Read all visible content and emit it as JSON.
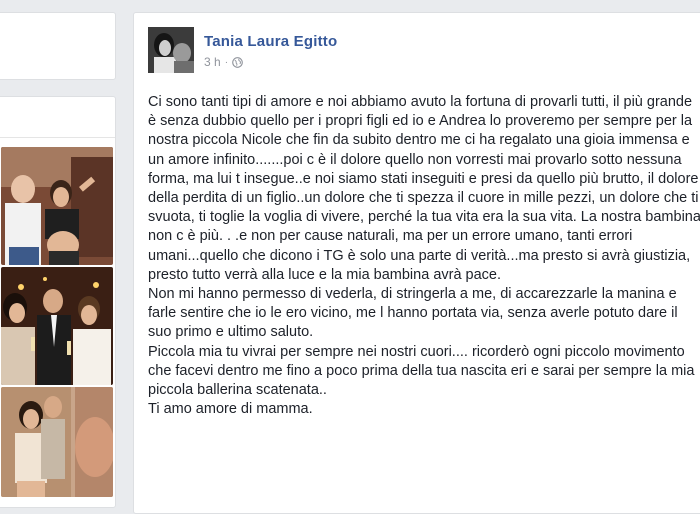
{
  "post": {
    "author": "Tania Laura Egitto",
    "time": "3 h",
    "separator": "·",
    "paragraphs": [
      "Ci sono tanti tipi di amore e noi abbiamo avuto la fortuna di provarli tutti, il più grande è senza dubbio quello per i propri figli ed io e Andrea lo proveremo per sempre per la nostra piccola Nicole che fin da subito dentro me ci ha regalato una gioia immensa e un amore infinito.......poi c è il dolore quello non vorresti mai provarlo sotto nessuna forma, ma lui t insegue..e noi siamo stati inseguiti e presi da quello più brutto, il dolore della perdita di un figlio..un dolore che ti spezza il cuore in mille pezzi, un dolore che ti svuota, ti toglie la voglia di vivere, perché la tua vita era la sua vita. La nostra bambina non c è più. . .e non per cause naturali, ma per un errore umano, tanti errori umani...quello che dicono i TG è solo una parte di verità...ma presto si avrà giustizia, presto tutto verrà alla luce e la mia bambina avrà pace.",
      "Non mi hanno permesso di vederla, di stringerla a me, di accarezzarle la manina e farle sentire che io le ero vicino, me l hanno portata via, senza averle potuto dare il suo primo e ultimo saluto.",
      "Piccola mia tu vivrai per sempre nei nostri cuori.... ricorderò ogni piccolo movimento che facevi dentro me fino a poco prima della tua nascita eri e sarai per sempre la mia piccola ballerina scatenata..",
      "Ti amo amore di mamma."
    ]
  },
  "icons": {
    "privacy": "globe-icon"
  },
  "colors": {
    "background": "#e9ebee",
    "author": "#365899",
    "meta": "#90949c",
    "text": "#1d2129"
  }
}
